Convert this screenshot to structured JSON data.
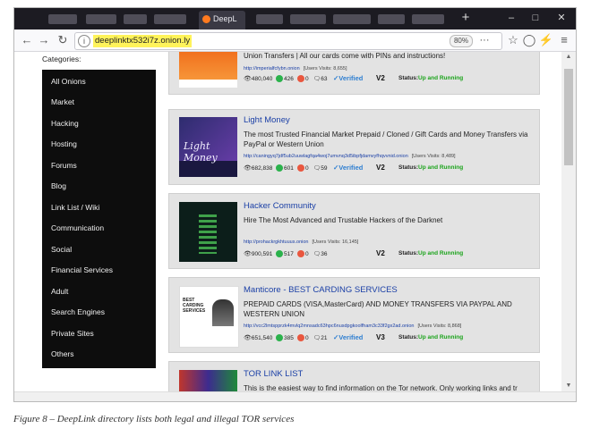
{
  "browser": {
    "tab_title": "DeepL",
    "url": "deeplinktx532i7z.onion.ly",
    "zoom": "80%",
    "new_tab_symbol": "+",
    "window_controls": {
      "minimize": "–",
      "maximize": "□",
      "close": "✕"
    }
  },
  "nav": {
    "back": "←",
    "forward": "→",
    "reload": "↻"
  },
  "url_icons": {
    "info": "i",
    "more": "···",
    "bookmark": "☆",
    "shield": "◯",
    "extension": "⚡",
    "menu": "≡"
  },
  "sidebar": {
    "heading": "Categories:",
    "items": [
      {
        "label": "All Onions"
      },
      {
        "label": "Market"
      },
      {
        "label": "Hacking"
      },
      {
        "label": "Hosting"
      },
      {
        "label": "Forums"
      },
      {
        "label": "Blog"
      },
      {
        "label": "Link List / Wiki"
      },
      {
        "label": "Communication"
      },
      {
        "label": "Social"
      },
      {
        "label": "Financial Services"
      },
      {
        "label": "Adult"
      },
      {
        "label": "Search Engines"
      },
      {
        "label": "Private Sites"
      },
      {
        "label": "Others"
      }
    ]
  },
  "listings": [
    {
      "title": "",
      "description": "Union Transfers | All our cards come with PINs and instructions!",
      "link": "http://imperialfcfybn.onion",
      "visits": "[Users Visits: 8,655]",
      "views": "480,040",
      "green_count": "426",
      "red_count": "0",
      "comments": "63",
      "verified": "Verified",
      "level": "2",
      "status_label": "Status:",
      "status_value": "Up and Running"
    },
    {
      "title": "Light Money",
      "description": "The most Trusted Financial Market Prepaid / Cloned / Gift Cards and Money Transfers via PayPal or Western Union",
      "link": "http://caningyq7jdf5ub2uuwlagfqa4woj7umvnq3d5ibpfjdamvyfhqvvnid.onion",
      "visits": "[Users Visits: 8,489]",
      "views": "682,838",
      "green_count": "601",
      "red_count": "0",
      "comments": "59",
      "verified": "Verified",
      "level": "2",
      "status_label": "Status:",
      "status_value": "Up and Running"
    },
    {
      "title": "Hacker Community",
      "description": "Hire The Most Advanced and Trustable Hackers of the Darknet",
      "link": "http://prohackrgkhtuuus.onion",
      "visits": "[Users Visits: 16,145]",
      "views": "900,591",
      "green_count": "517",
      "red_count": "0",
      "comments": "36",
      "verified": "",
      "level": "2",
      "status_label": "Status:",
      "status_value": "Up and Running"
    },
    {
      "title": "Manticore - BEST CARDING SERVICES",
      "description": "PREPAID CARDS (VISA,MasterCard) AND MONEY TRANSFERS VIA PAYPAL AND WESTERN UNION",
      "link": "http://vcc2lmtspprzk4mvlq2mnsadc63hpc6nusdpgkoolfham3c33f2gx2ad.onion",
      "visits": "[Users Visits: 8,868]",
      "views": "651,540",
      "green_count": "385",
      "red_count": "0",
      "comments": "21",
      "verified": "Verified",
      "level": "3",
      "status_label": "Status:",
      "status_value": "Up and Running"
    },
    {
      "title": "TOR LINK LIST",
      "description": "This is the easiest way to find information on the Tor network. Only working links and tr",
      "link": "",
      "visits": "",
      "views": "",
      "green_count": "",
      "red_count": "",
      "comments": "",
      "verified": "",
      "level": "",
      "status_label": "",
      "status_value": ""
    }
  ],
  "thumb_texts": {
    "light_money": "Light Money",
    "manticore": "BEST CARDING SERVICES"
  },
  "caption": "Figure 8 – DeepLink directory lists both legal and illegal TOR services",
  "colors": {
    "link": "#1a3fa6",
    "status": "#1aa31a",
    "verified": "#2f7fd1",
    "sidebar": "#0d0d0d",
    "url_highlight": "#fff35a"
  }
}
